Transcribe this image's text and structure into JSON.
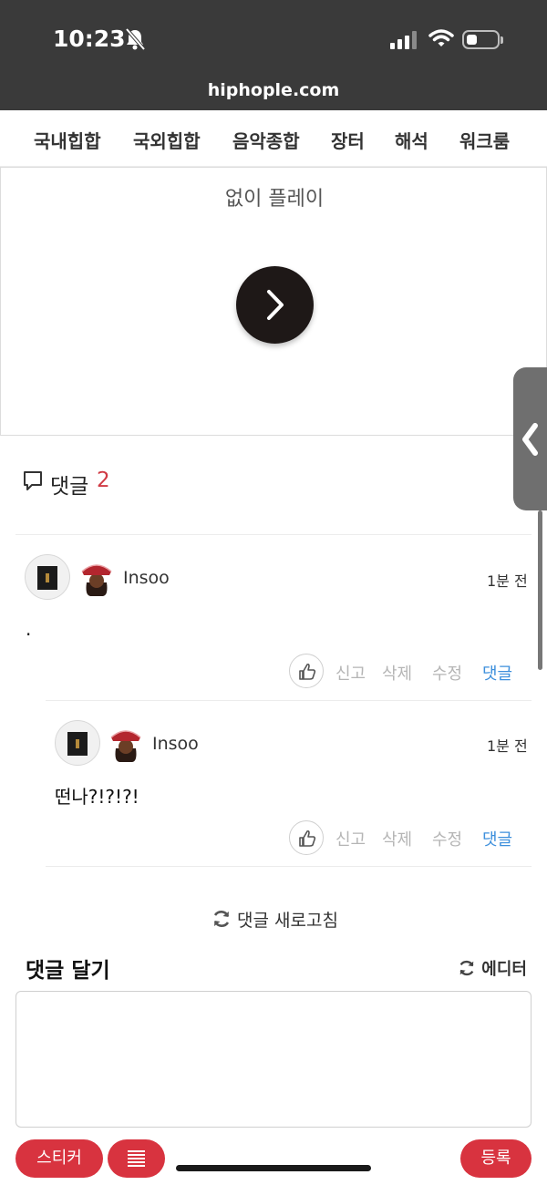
{
  "status_bar": {
    "time": "10:23"
  },
  "browser": {
    "url": "hiphople.com"
  },
  "nav": {
    "items": [
      "국내힙합",
      "국외힙합",
      "음악종합",
      "장터",
      "해석",
      "워크룸"
    ]
  },
  "player": {
    "title": "없이 플레이"
  },
  "comments": {
    "label": "댓글",
    "count": "2",
    "items": [
      {
        "user": "Insoo",
        "time": "1분 전",
        "text": ".",
        "actions": [
          "신고",
          "삭제",
          "수정",
          "댓글"
        ]
      },
      {
        "user": "Insoo",
        "time": "1분 전",
        "text": "떤나?!?!?!",
        "actions": [
          "신고",
          "삭제",
          "수정",
          "댓글"
        ]
      }
    ],
    "refresh_label": "댓글 새로고침"
  },
  "composer": {
    "title": "댓글 달기",
    "editor_label": "에디터",
    "placeholder": "",
    "sticker_label": "스티커",
    "submit_label": "등록"
  },
  "colors": {
    "accent": "#d8333f",
    "reply_link": "#3d8fdc",
    "count": "#d03a44"
  }
}
